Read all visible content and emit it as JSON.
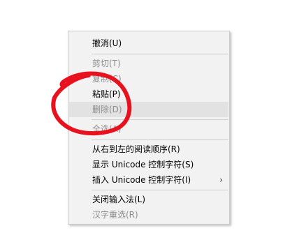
{
  "context_menu": {
    "items": [
      {
        "label": "撤消(U)",
        "enabled": true
      },
      {
        "label": "剪切(T)",
        "enabled": false
      },
      {
        "label": "复制(C)",
        "enabled": false
      },
      {
        "label": "粘贴(P)",
        "enabled": true
      },
      {
        "label": "删除(D)",
        "enabled": false,
        "highlighted": true
      },
      {
        "label": "全选(A)",
        "enabled": false
      },
      {
        "label": "从右到左的阅读顺序(R)",
        "enabled": true
      },
      {
        "label": "显示 Unicode 控制字符(S)",
        "enabled": true
      },
      {
        "label": "插入 Unicode 控制字符(I)",
        "enabled": true,
        "submenu_icon": "chevron-right-icon",
        "submenu_glyph": "›"
      },
      {
        "label": "关闭输入法(L)",
        "enabled": true
      },
      {
        "label": "汉字重选(R)",
        "enabled": false
      }
    ]
  },
  "colors": {
    "menu_background": "#f2f2f2",
    "highlight": "#e2e2e2",
    "disabled_text": "#8d8d8d",
    "annotation_stroke": "#e8121f"
  }
}
